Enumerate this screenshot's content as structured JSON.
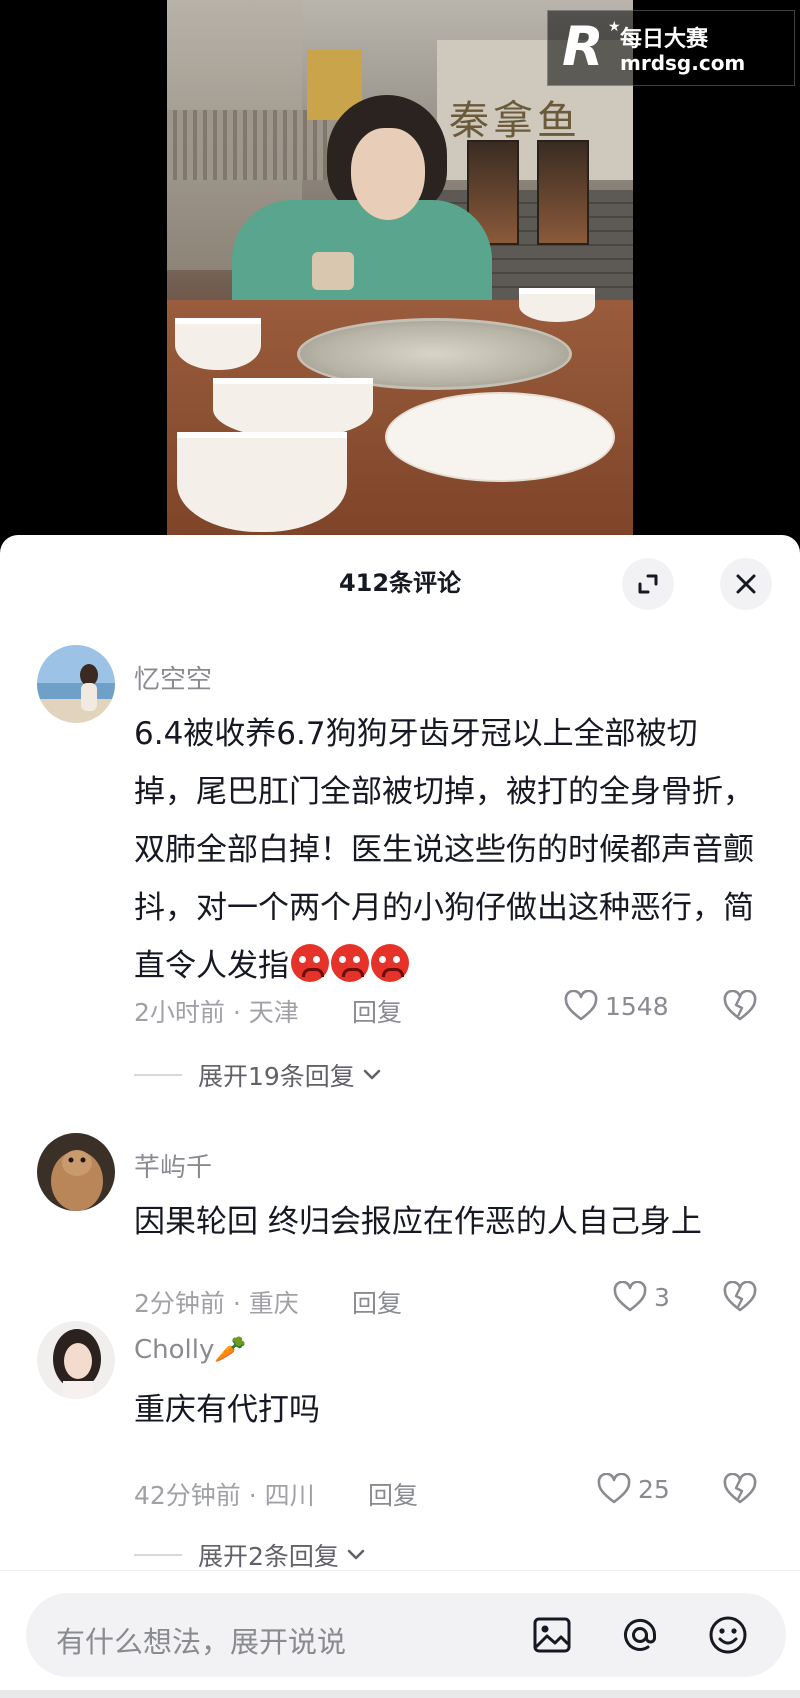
{
  "watermark": {
    "logo_letter": "R",
    "brand_cn": "每日大赛",
    "url": "mrdsg.com"
  },
  "video": {
    "sign_text": "秦拿鱼"
  },
  "header": {
    "title": "412条评论"
  },
  "comments": [
    {
      "username": "忆空空",
      "text": "6.4被收养6.7狗狗牙齿牙冠以上全部被切掉，尾巴肛门全部被切掉，被打的全身骨折，双肺全部白掉！医生说这些伤的时候都声音颤抖，对一个两个月的小狗仔做出这种恶行，简直令人发指",
      "emoji": "angry-face",
      "emoji_count": 3,
      "time_location": "2小时前 · 天津",
      "reply_label": "回复",
      "likes": "1548",
      "expand_label": "展开19条回复"
    },
    {
      "username": "芊屿千",
      "text": "因果轮回 终归会报应在作恶的人自己身上",
      "time_location": "2分钟前 · 重庆",
      "reply_label": "回复",
      "likes": "3"
    },
    {
      "username": "Cholly🥕",
      "text": "重庆有代打吗",
      "time_location": "42分钟前 · 四川",
      "reply_label": "回复",
      "likes": "25",
      "expand_label": "展开2条回复"
    }
  ],
  "input": {
    "placeholder": "有什么想法，展开说说",
    "icons": [
      "image-icon",
      "at-icon",
      "emoji-icon"
    ]
  },
  "colors": {
    "text_primary": "#161823",
    "text_secondary": "#8a8b91",
    "sheet_bg": "#ffffff",
    "emoji_red": "#e5332a"
  }
}
